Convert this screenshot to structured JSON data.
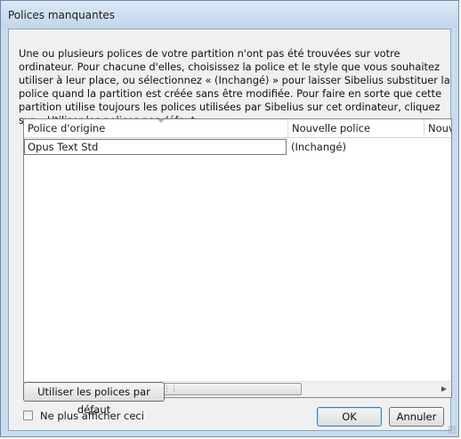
{
  "window": {
    "title": "Polices manquantes"
  },
  "description": "Une ou plusieurs polices de votre partition n'ont pas été trouvées sur votre ordinateur. Pour chacune d'elles, choisissez la police et le style que vous souhaitez utiliser à leur place, ou sélectionnez « (Inchangé) » pour laisser Sibelius substituer la police quand la partition est créée sans être modifiée. Pour faire en sorte que cette partition utilise toujours les polices utilisées par Sibelius sur cet ordinateur, cliquez sur « Utiliser les polices par défaut »",
  "table": {
    "columns": [
      "Police d'origine",
      "Nouvelle police",
      "Nouve"
    ],
    "rows": [
      {
        "original": "Opus Text Std",
        "new_font": "(Inchangé)",
        "new_style": ""
      }
    ]
  },
  "buttons": {
    "use_defaults": "Utiliser les polices par défaut",
    "ok": "OK",
    "cancel": "Annuler"
  },
  "checkbox": {
    "label": "Ne plus afficher ceci",
    "checked": false
  },
  "icons": {
    "scroll_left": "scroll-left-icon",
    "scroll_right": "scroll-right-icon",
    "sort": "sort-arrow-icon",
    "grip": "resize-grip-icon"
  }
}
